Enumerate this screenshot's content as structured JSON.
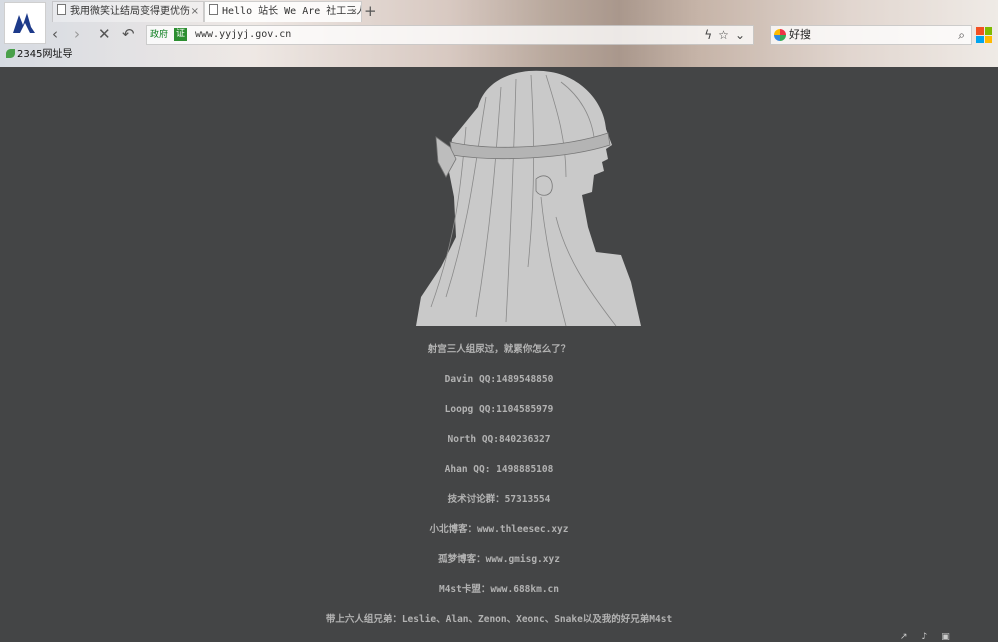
{
  "browser": {
    "tabs": [
      {
        "label": "我用微笑让结局变得更优伤",
        "active": false
      },
      {
        "label": "Hello 站长 We Are 社工三人",
        "active": true
      }
    ],
    "new_tab_label": "+",
    "url": "www.yyjyj.gov.cn",
    "gov_label": "政府",
    "gov_badge": "证",
    "search_engine": "好搜",
    "bookmark": "2345网址导"
  },
  "page": {
    "lines": [
      "射宫三人组尿过，就累你怎么了？",
      "Davin QQ:1489548850",
      "Loopg QQ:1104585979",
      "North QQ:840236327",
      "Ahan QQ: 1498885108",
      "技术讨论群：57313554",
      "小北博客：www.thleesec.xyz",
      "孤梦博客：www.gmisg.xyz",
      "M4st卡盟：www.688km.cn",
      "带上六人组兄弟：Leslie、Alan、Zenon、Xeonc、Snake以及我的好兄弟M4st"
    ]
  },
  "colors": {
    "background": "#444546",
    "text": "#b2b2b2",
    "art": "#c9c9c9"
  }
}
